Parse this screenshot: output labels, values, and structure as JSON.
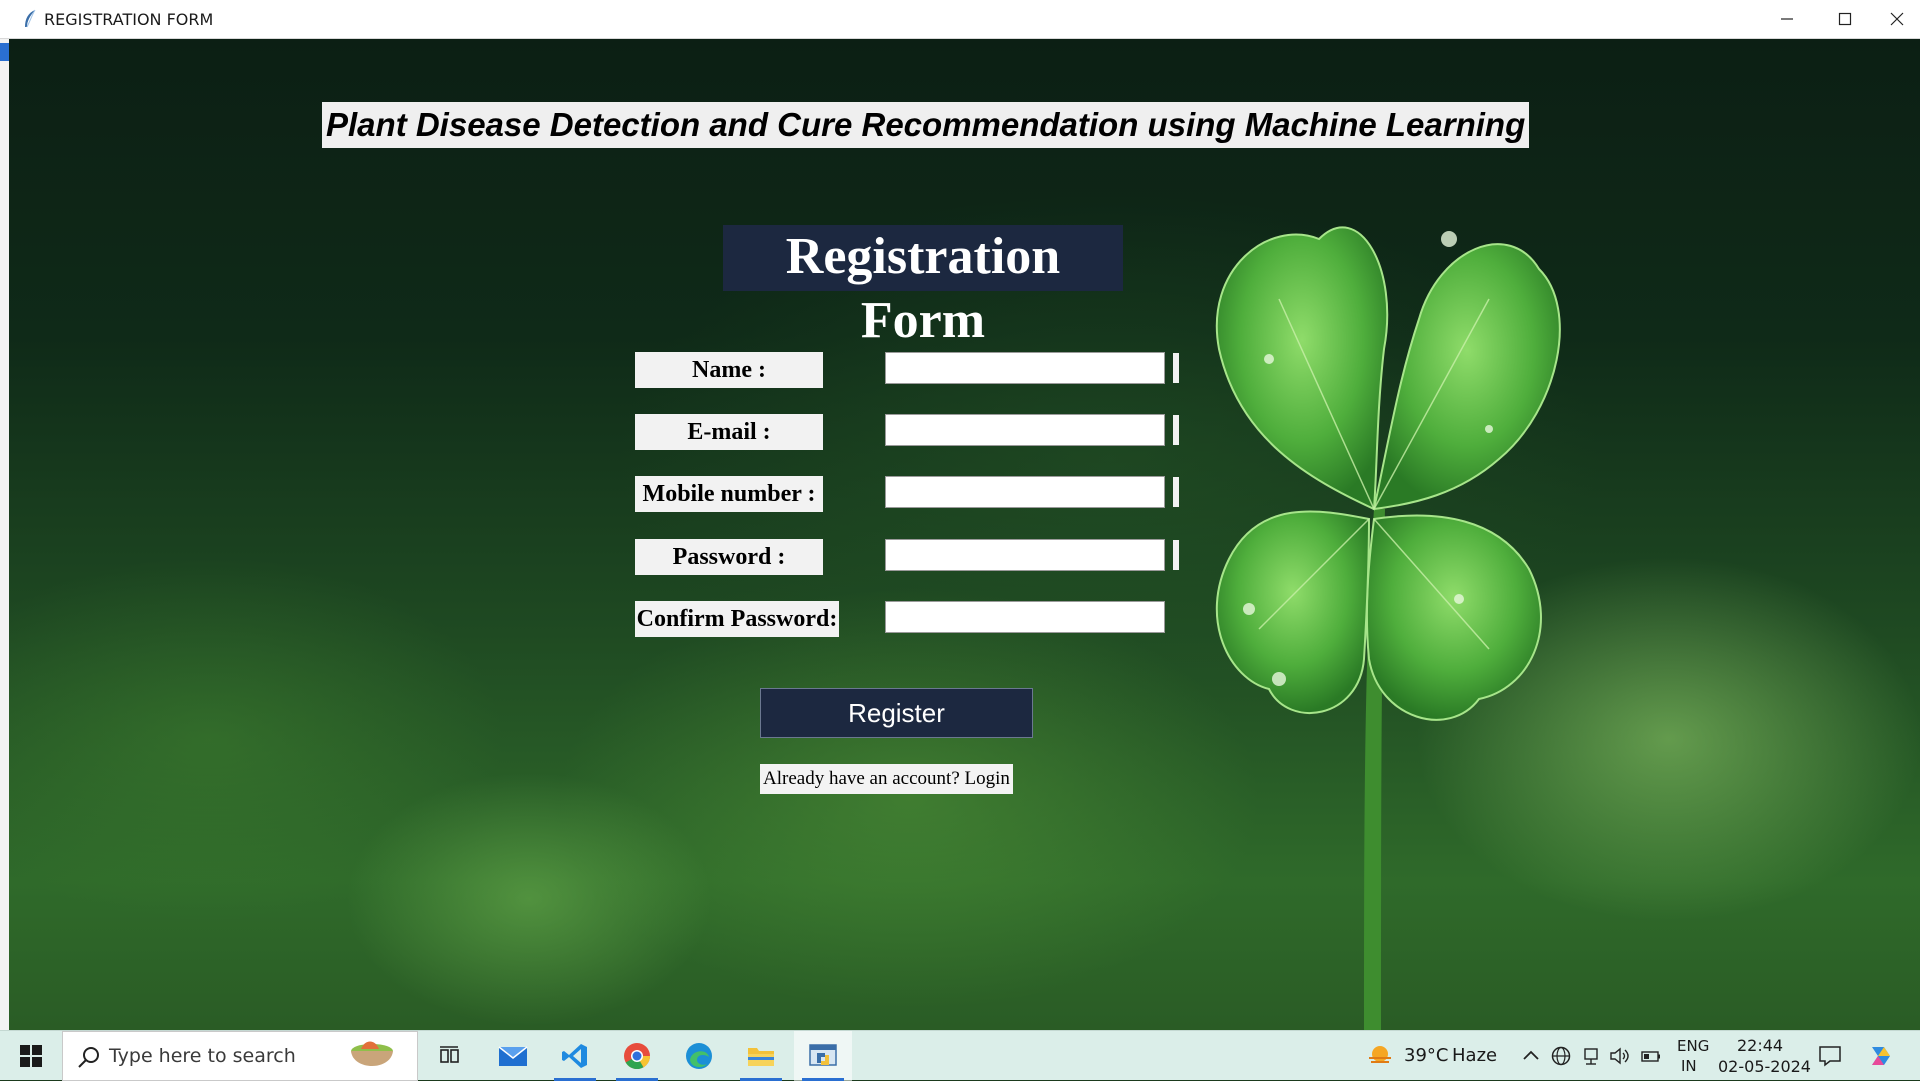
{
  "window": {
    "title": "REGISTRATION FORM"
  },
  "app": {
    "main_title": "Plant Disease Detection and Cure Recommendation using Machine Learning",
    "form_heading": "Registration Form",
    "fields": [
      {
        "label": "Name :",
        "value": ""
      },
      {
        "label": "E-mail :",
        "value": ""
      },
      {
        "label": "Mobile number :",
        "value": ""
      },
      {
        "label": "Password :",
        "value": ""
      },
      {
        "label": "Confirm Password:",
        "value": ""
      }
    ],
    "register_label": "Register",
    "login_link": "Already have an account? Login"
  },
  "taskbar": {
    "search_placeholder": "Type here to search",
    "apps": [
      "task-view",
      "mail",
      "vs-code",
      "chrome",
      "edge",
      "file-explorer",
      "python"
    ],
    "weather": {
      "temp": "39°C",
      "condition": "Haze"
    },
    "lang_top": "ENG",
    "lang_bottom": "IN",
    "time": "22:44",
    "date": "02-05-2024"
  },
  "colors": {
    "accent": "#1c2840",
    "taskbar": "#dbeee9",
    "clover": "#4fae3c"
  }
}
